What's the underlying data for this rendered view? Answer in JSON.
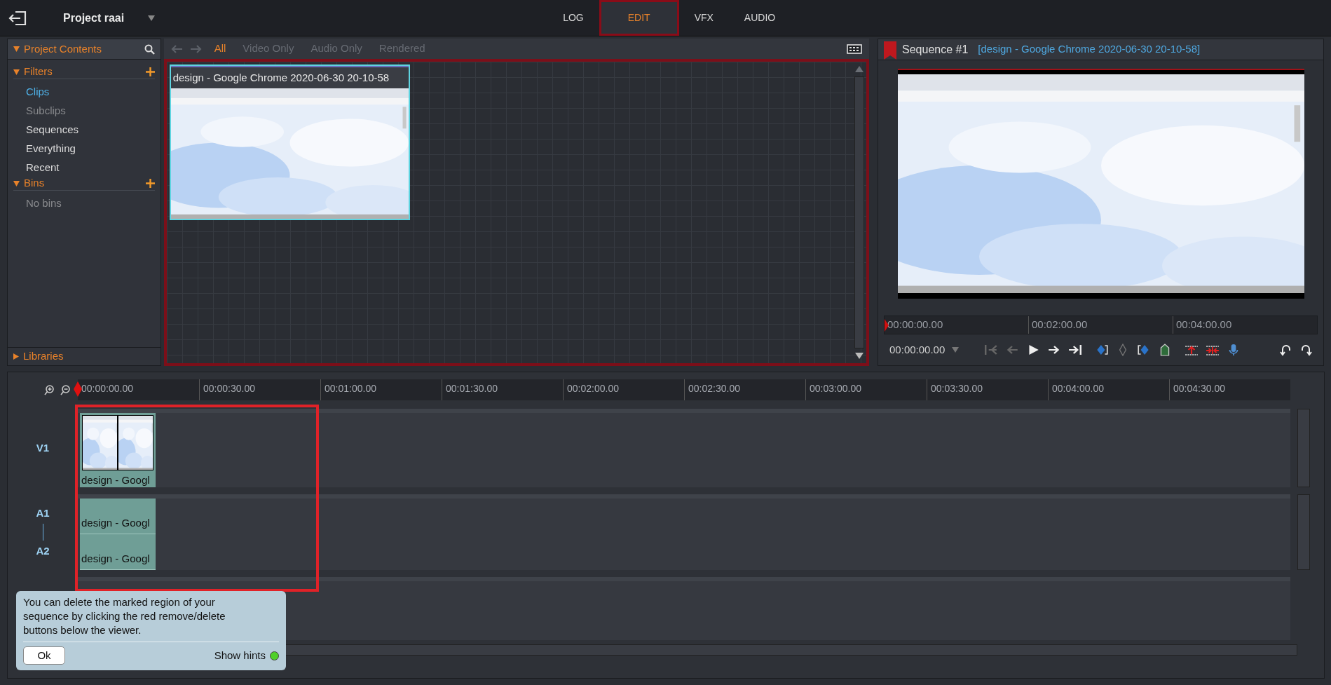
{
  "header": {
    "project": "Project raai"
  },
  "tabs": [
    {
      "label": "LOG",
      "selected": false
    },
    {
      "label": "EDIT",
      "selected": true
    },
    {
      "label": "VFX",
      "selected": false
    },
    {
      "label": "AUDIO",
      "selected": false
    }
  ],
  "sidebar": {
    "title": "Project Contents",
    "sections": [
      {
        "label": "Filters",
        "expanded": true,
        "items": [
          {
            "label": "Clips",
            "selected": true,
            "disabled": false
          },
          {
            "label": "Subclips",
            "selected": false,
            "disabled": true
          },
          {
            "label": "Sequences",
            "selected": false,
            "disabled": false
          },
          {
            "label": "Everything",
            "selected": false,
            "disabled": false
          },
          {
            "label": "Recent",
            "selected": false,
            "disabled": false
          }
        ]
      },
      {
        "label": "Bins",
        "expanded": true,
        "items": [
          {
            "label": "No bins",
            "selected": false,
            "disabled": true
          }
        ]
      }
    ],
    "footer": {
      "label": "Libraries",
      "expanded": false
    }
  },
  "browser": {
    "filters": [
      {
        "label": "All",
        "selected": true
      },
      {
        "label": "Video Only",
        "selected": false
      },
      {
        "label": "Audio Only",
        "selected": false
      },
      {
        "label": "Rendered",
        "selected": false
      }
    ],
    "clips": [
      {
        "title": "design - Google Chrome 2020-06-30 20-10-58",
        "kind": "picture"
      }
    ]
  },
  "viewer": {
    "title": "Sequence #1",
    "clip": "[design - Google Chrome 2020-06-30 20-10-58]",
    "ruler": [
      "00:00:00.00",
      "00:02:00.00",
      "00:04:00.00"
    ],
    "timecode": "00:00:00.00"
  },
  "timeline": {
    "ruler": [
      "00:00:00.00",
      "00:00:30.00",
      "00:01:00.00",
      "00:01:30.00",
      "00:02:00.00",
      "00:02:30.00",
      "00:03:00.00",
      "00:03:30.00",
      "00:04:00.00",
      "00:04:30.00"
    ],
    "tracks": [
      {
        "kind": "video",
        "labels": [
          "V1"
        ],
        "clips": [
          "design - Googl"
        ]
      },
      {
        "kind": "audio",
        "labels": [
          "A1",
          "A2"
        ],
        "clips": [
          "design - Googl",
          "design - Googl"
        ]
      }
    ]
  },
  "hint": {
    "text": "You can delete the marked region of your sequence by clicking the red remove/delete buttons below the viewer.",
    "button": "Ok",
    "toggle": "Show hints",
    "on": true
  }
}
